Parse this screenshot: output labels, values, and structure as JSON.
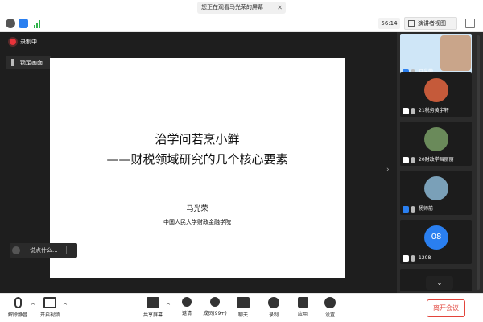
{
  "banner": {
    "text": "您正在观看马光荣的屏幕",
    "close": "✕"
  },
  "toolbar": {
    "timer": "56:14",
    "presenter_view": "演讲者视图"
  },
  "stage": {
    "recording": "录制中",
    "lock_screen": "锁定画面",
    "slide": {
      "title_line1": "治学问若烹小鲜",
      "title_line2": "——财税领域研究的几个核心要素",
      "author": "马光荣",
      "affiliation": "中国人民大学财政金融学院"
    },
    "chat_placeholder": "说点什么...",
    "next_arrow": "›"
  },
  "sidebar": {
    "tiles": [
      {
        "name": "马光荣",
        "avatar_color": "#c9a58a"
      },
      {
        "name": "21税务黄宇轩",
        "avatar_color": "#c55a3a"
      },
      {
        "name": "20财政学吕丽丽",
        "avatar_color": "#6a8a5a"
      },
      {
        "name": "杨师前",
        "avatar_color": "#7aa0b8"
      },
      {
        "name": "1208",
        "avatar_text": "08",
        "avatar_color": "#2a7ff0"
      }
    ],
    "scroll_down": "⌄"
  },
  "bottombar": {
    "mute": "解除静音",
    "video": "开启视频",
    "share": "共享屏幕",
    "invite": "邀请",
    "members": "成员(99+)",
    "chat": "聊天",
    "record": "录制",
    "apps": "应用",
    "settings": "设置",
    "leave": "离开会议"
  },
  "colors": {
    "accent": "#2a7ff0",
    "danger": "#e2443b",
    "record": "#e8333a"
  }
}
